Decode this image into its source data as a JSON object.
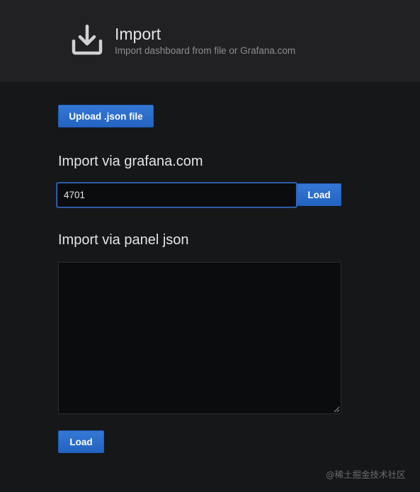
{
  "header": {
    "icon": "download-icon",
    "title": "Import",
    "subtitle": "Import dashboard from file or Grafana.com"
  },
  "upload": {
    "label": "Upload .json file"
  },
  "grafana_com": {
    "title": "Import via grafana.com",
    "input_value": "4701",
    "load_label": "Load"
  },
  "panel_json": {
    "title": "Import via panel json",
    "textarea_value": "",
    "load_label": "Load"
  },
  "watermark": "@稀土掘金技术社区",
  "colors": {
    "background": "#161719",
    "header_background": "#212124",
    "primary_button": "#2f6fd0",
    "input_background": "#0b0c0e",
    "input_focus_border": "#3b6fc5"
  }
}
